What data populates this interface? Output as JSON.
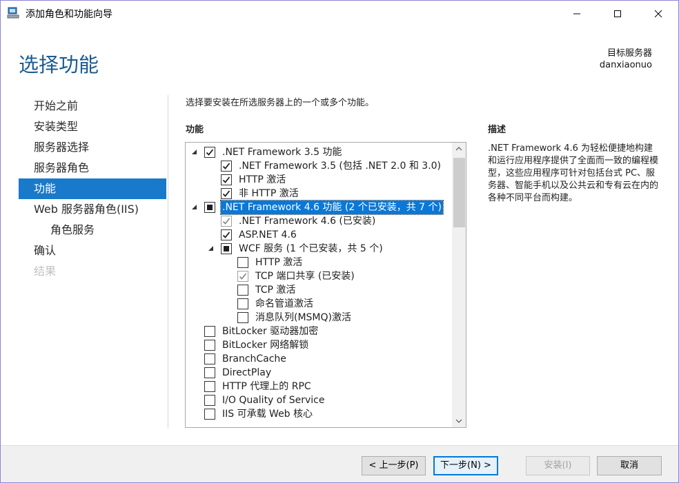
{
  "window": {
    "title": "添加角色和功能向导",
    "controls": {
      "minimize": "minimize",
      "maximize": "maximize",
      "close": "close"
    }
  },
  "header": {
    "title": "选择功能",
    "target_label": "目标服务器",
    "target_server": "danxiaonuo"
  },
  "nav": {
    "items": [
      {
        "label": "开始之前",
        "state": "normal"
      },
      {
        "label": "安装类型",
        "state": "normal"
      },
      {
        "label": "服务器选择",
        "state": "normal"
      },
      {
        "label": "服务器角色",
        "state": "normal"
      },
      {
        "label": "功能",
        "state": "active"
      },
      {
        "label": "Web 服务器角色(IIS)",
        "state": "normal"
      },
      {
        "label": "角色服务",
        "state": "normal",
        "sub": true
      },
      {
        "label": "确认",
        "state": "normal"
      },
      {
        "label": "结果",
        "state": "disabled"
      }
    ]
  },
  "main": {
    "instruction": "选择要安装在所选服务器上的一个或多个功能。",
    "features_label": "功能",
    "description_label": "描述",
    "description_text": ".NET Framework 4.6 为轻松便捷地构建和运行应用程序提供了全面而一致的编程模型，这些应用程序可针对包括台式 PC、服务器、智能手机以及公共云和专有云在内的各种不同平台而构建。",
    "features": [
      {
        "label": ".NET Framework 3.5 功能",
        "level": 0,
        "expander": "expanded",
        "state": "checked"
      },
      {
        "label": ".NET Framework 3.5 (包括 .NET 2.0 和 3.0)",
        "level": 1,
        "expander": "none",
        "state": "checked"
      },
      {
        "label": "HTTP 激活",
        "level": 1,
        "expander": "none",
        "state": "checked"
      },
      {
        "label": "非 HTTP 激活",
        "level": 1,
        "expander": "none",
        "state": "checked"
      },
      {
        "label": ".NET Framework 4.6 功能 (2 个已安装，共 7 个)",
        "level": 0,
        "expander": "expanded",
        "state": "partial",
        "selected": true
      },
      {
        "label": ".NET Framework 4.6 (已安装)",
        "level": 1,
        "expander": "none",
        "state": "checked-disabled"
      },
      {
        "label": "ASP.NET 4.6",
        "level": 1,
        "expander": "none",
        "state": "checked"
      },
      {
        "label": "WCF 服务 (1 个已安装，共 5 个)",
        "level": 1,
        "expander": "expanded",
        "state": "partial"
      },
      {
        "label": "HTTP 激活",
        "level": 2,
        "expander": "none",
        "state": "unchecked"
      },
      {
        "label": "TCP 端口共享 (已安装)",
        "level": 2,
        "expander": "none",
        "state": "checked-disabled"
      },
      {
        "label": "TCP 激活",
        "level": 2,
        "expander": "none",
        "state": "unchecked"
      },
      {
        "label": "命名管道激活",
        "level": 2,
        "expander": "none",
        "state": "unchecked"
      },
      {
        "label": "消息队列(MSMQ)激活",
        "level": 2,
        "expander": "none",
        "state": "unchecked"
      },
      {
        "label": "BitLocker 驱动器加密",
        "level": 0,
        "expander": "none",
        "state": "unchecked"
      },
      {
        "label": "BitLocker 网络解锁",
        "level": 0,
        "expander": "none",
        "state": "unchecked"
      },
      {
        "label": "BranchCache",
        "level": 0,
        "expander": "none",
        "state": "unchecked"
      },
      {
        "label": "DirectPlay",
        "level": 0,
        "expander": "none",
        "state": "unchecked"
      },
      {
        "label": "HTTP 代理上的 RPC",
        "level": 0,
        "expander": "none",
        "state": "unchecked"
      },
      {
        "label": "I/O Quality of Service",
        "level": 0,
        "expander": "none",
        "state": "unchecked"
      },
      {
        "label": "IIS 可承载 Web 核心",
        "level": 0,
        "expander": "none",
        "state": "unchecked"
      }
    ]
  },
  "footer": {
    "prev_label": "< 上一步(P)",
    "next_label": "下一步(N) >",
    "install_label": "安装(I)",
    "cancel_label": "取消"
  },
  "colors": {
    "title_blue": "#1b5c8f",
    "nav_active": "#1979ca",
    "selection": "#0a78d7",
    "window_border": "#8e84d6"
  }
}
